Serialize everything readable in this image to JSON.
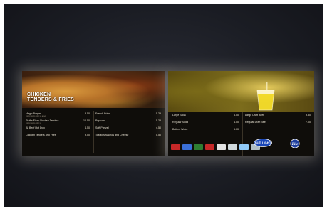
{
  "left_board": {
    "title": "Chicken Tenders & Fries",
    "col1": [
      {
        "name": "Magic Burger",
        "price": "8.50",
        "desc": "lorem ipsum dolor sit amet"
      },
      {
        "name": "Stuff's Fiery Chicken Tenders",
        "price": "10.50",
        "desc": "lorem ipsum dolor sit"
      },
      {
        "name": "All Beef Hot Dog",
        "price": "4.50",
        "desc": ""
      },
      {
        "name": "Chicken Tenders and Fries",
        "price": "9.50",
        "desc": ""
      }
    ],
    "col2": [
      {
        "name": "French Fries",
        "price": "5.25"
      },
      {
        "name": "Popcorn",
        "price": "5.25"
      },
      {
        "name": "Soft Pretzel",
        "price": "4.50"
      },
      {
        "name": "Tostito's Nachos and Cheese",
        "price": "5.50"
      }
    ]
  },
  "right_board": {
    "col1": [
      {
        "name": "Large Soda",
        "price": "6.00"
      },
      {
        "name": "Regular Soda",
        "price": "4.50"
      },
      {
        "name": "Bottled Water",
        "price": "5.00"
      }
    ],
    "col2": [
      {
        "name": "Large Draft Beer",
        "price": "9.50"
      },
      {
        "name": "Regular Draft Beer",
        "price": "7.00"
      }
    ],
    "payment_logos": [
      "#c62828",
      "#3a6fd8",
      "#2e7d32",
      "#c62828",
      "#e3e3e3",
      "#cfd8dc",
      "#90caf9",
      "#b0bec5"
    ],
    "brands": {
      "bud": "BUD LIGHT",
      "lite": "Lite"
    }
  }
}
